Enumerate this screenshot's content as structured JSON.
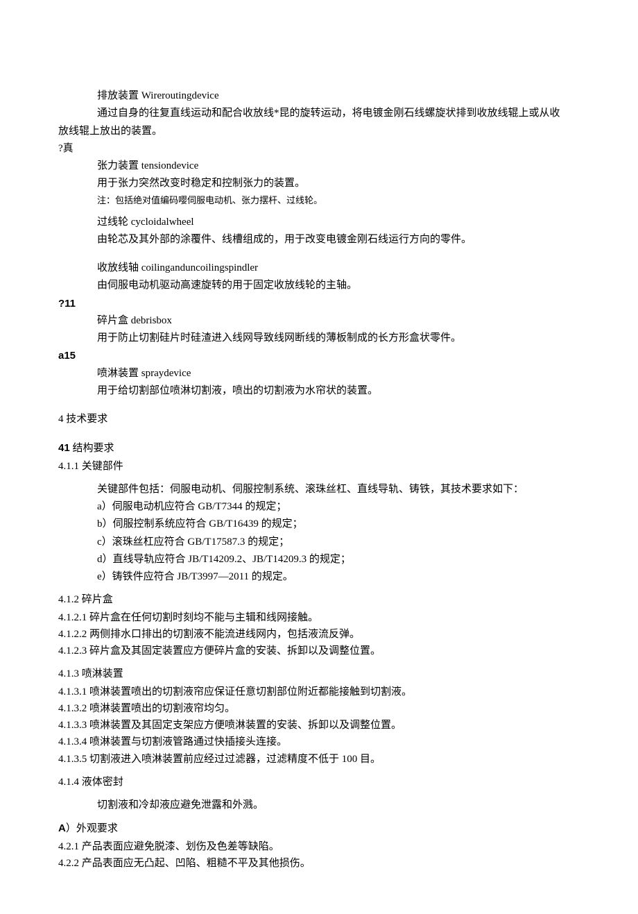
{
  "t1_line1": "排放装置 Wireroutingdevice",
  "t1_line2": "通过自身的往复直线运动和配合收放线*昆的旋转运动，将电镀金刚石线螺旋状排到收放线辊上或从收",
  "t1_line3": "放线辊上放出的装置。",
  "m1": "?真",
  "t2_line1": "张力装置 tensiondevice",
  "t2_line2": "用于张力突然改变时稳定和控制张力的装置。",
  "t2_note": "注：包括绝对值编码嘤伺服电动机、张力摆杆、过线轮。",
  "t3_line1": "过线轮 cycloidalwheel",
  "t3_line2": "由轮芯及其外部的涂覆件、线槽组成的，用于改变电镀金刚石线运行方向的零件。",
  "t4_line1": "收放线轴 coilinganduncoilingspindler",
  "t4_line2": "由伺服电动机驱动高速旋转的用于固定收放线轮的主轴。",
  "m2": "?11",
  "t5_line1": "碎片盒 debrisbox",
  "t5_line2": "用于防止切割硅片时硅渣进入线网导致线网断线的薄板制成的长方形盒状零件。",
  "m3": "a15",
  "t6_line1": "喷淋装置 spraydevice",
  "t6_line2": "用于给切割部位喷淋切割液，喷出的切割液为水帘状的装置。",
  "s4": "4 技术要求",
  "s41": "41 结构要求",
  "s411": "4.1.1 关键部件",
  "s411_intro": "关键部件包括：伺服电动机、伺服控制系统、滚珠丝杠、直线导轨、铸铁，其技术要求如下：",
  "s411_a": "a）伺服电动机应符合 GB/T7344 的规定；",
  "s411_b": "b）伺服控制系统应符合 GB/T16439 的规定；",
  "s411_c": "c）滚珠丝杠应符合 GB/T17587.3 的规定；",
  "s411_d": "d）直线导轨应符合 JB/T14209.2、JB/T14209.3 的规定；",
  "s411_e": "e）铸铁件应符合 JB/T3997—2011 的规定。",
  "s412": "4.1.2 碎片盒",
  "s4121": "4.1.2.1 碎片盒在任何切割时刻均不能与主辑和线网接触。",
  "s4122": "4.1.2.2 两侧排水口排出的切割液不能流进线网内，包括液流反弹。",
  "s4123": "4.1.2.3 碎片盒及其固定装置应方便碎片盒的安装、拆卸以及调整位置。",
  "s413": "4.1.3 喷淋装置",
  "s4131": "4.1.3.1 喷淋装置喷出的切割液帘应保证任意切割部位附近都能接触到切割液。",
  "s4132": "4.1.3.2 喷淋装置喷出的切割液帘均匀。",
  "s4133": "4.1.3.3 喷淋装置及其固定支架应方便喷淋装置的安装、拆卸以及调整位置。",
  "s4134": "4.1.3.4 喷淋装置与切割液管路通过快插接头连接。",
  "s4135": "4.1.3.5 切割液进入喷淋装置前应经过过滤器，过滤精度不低于 100 目。",
  "s414": "4.1.4 液体密封",
  "s414_body": "切割液和冷却液应避免泄露和外溅。",
  "sA": "A）外观要求",
  "s421": "4.2.1 产品表面应避免脱漆、划伤及色差等缺陷。",
  "s422": "4.2.2 产品表面应无凸起、凹陷、粗糙不平及其他损伤。"
}
